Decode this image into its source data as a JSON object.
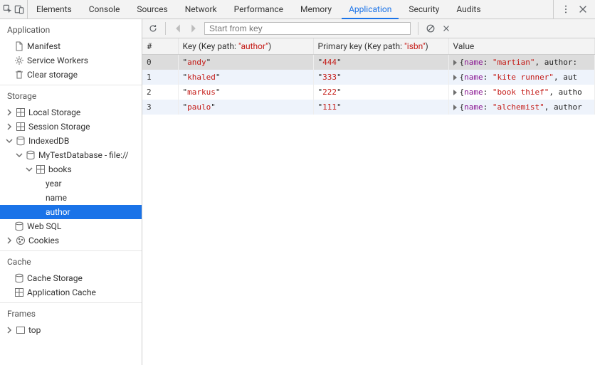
{
  "tabs": [
    "Elements",
    "Console",
    "Sources",
    "Network",
    "Performance",
    "Memory",
    "Application",
    "Security",
    "Audits"
  ],
  "active_tab_index": 6,
  "sidebar": {
    "application": {
      "title": "Application",
      "items": [
        "Manifest",
        "Service Workers",
        "Clear storage"
      ]
    },
    "storage": {
      "title": "Storage",
      "local_storage": "Local Storage",
      "session_storage": "Session Storage",
      "indexeddb": {
        "label": "IndexedDB",
        "db": {
          "label": "MyTestDatabase - file://",
          "store": {
            "label": "books",
            "indexes": [
              "year",
              "name",
              "author"
            ],
            "selected_index": 2
          }
        }
      },
      "websql": "Web SQL",
      "cookies": "Cookies"
    },
    "cache": {
      "title": "Cache",
      "items": [
        "Cache Storage",
        "Application Cache"
      ]
    },
    "frames": {
      "title": "Frames",
      "top": "top"
    }
  },
  "toolbar": {
    "search_placeholder": "Start from key"
  },
  "grid": {
    "headers": {
      "index": "#",
      "key_label": "Key (Key path: ",
      "key_path": "\"author\"",
      "key_close": ")",
      "pkey_label": "Primary key (Key path: ",
      "pkey_path": "\"isbn\"",
      "pkey_close": ")",
      "value": "Value"
    },
    "rows": [
      {
        "idx": "0",
        "key": "andy",
        "pkey": "444",
        "valname": "martian",
        "valtrail": ", author:"
      },
      {
        "idx": "1",
        "key": "khaled",
        "pkey": "333",
        "valname": "kite runner",
        "valtrail": ", aut"
      },
      {
        "idx": "2",
        "key": "markus",
        "pkey": "222",
        "valname": "book thief",
        "valtrail": ", autho"
      },
      {
        "idx": "3",
        "key": "paulo",
        "pkey": "111",
        "valname": "alchemist",
        "valtrail": ", author"
      }
    ],
    "selected_row": 0
  }
}
